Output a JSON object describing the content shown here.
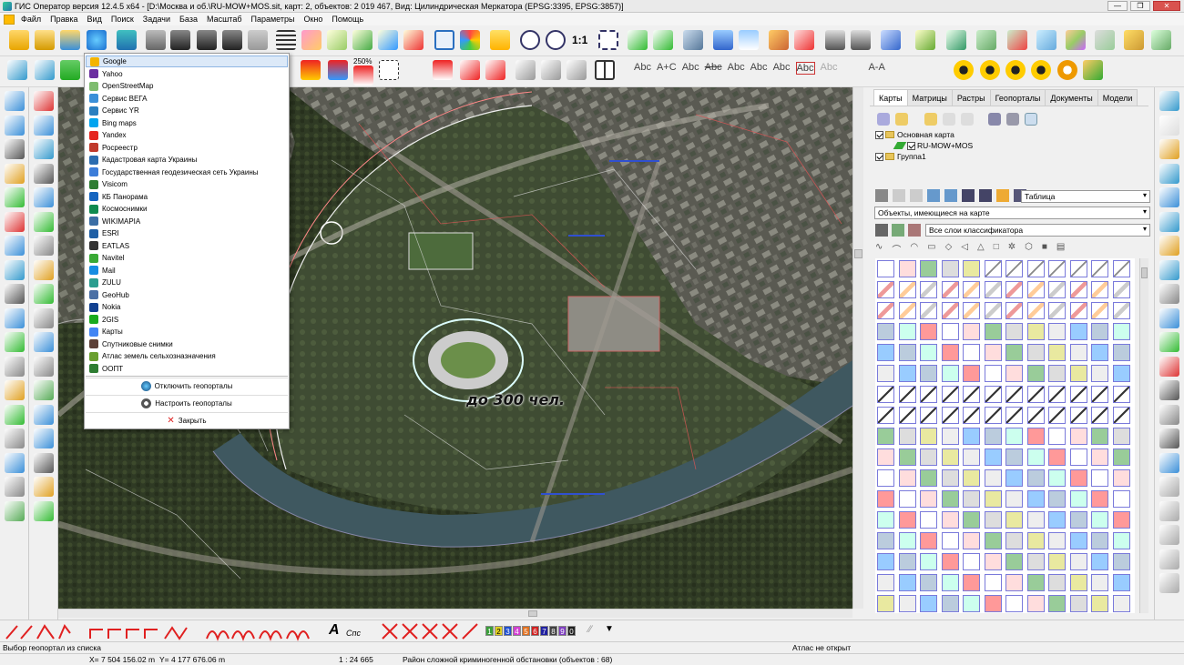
{
  "window": {
    "title": "ГИС Оператор версия 12.4.5 x64 - [D:\\Москва и об.\\RU-MOW+MOS.sit, карт: 2, объектов: 2 019 467, Вид: Цилиндрическая Меркатора (EPSG:3395, EPSG:3857)]",
    "minimize": "—",
    "maximize": "❐",
    "close": "✕"
  },
  "menu": [
    "Файл",
    "Правка",
    "Вид",
    "Поиск",
    "Задачи",
    "База",
    "Масштаб",
    "Параметры",
    "Окно",
    "Помощь"
  ],
  "toolbar": {
    "zoom_ratio": "1:1",
    "zoom_percent": "250%",
    "text_tools": [
      "Abc",
      "A+C",
      "Abc",
      "Abc",
      "Abc",
      "Abc",
      "Abc",
      "Abc",
      "Abc",
      "A-A"
    ]
  },
  "geoportal_menu": {
    "items": [
      {
        "label": "Google",
        "color": "#f4b400",
        "selected": true
      },
      {
        "label": "Yahoo",
        "color": "#6b2fa0"
      },
      {
        "label": "OpenStreetMap",
        "color": "#7ebc6f"
      },
      {
        "label": "Сервис ВЕГА",
        "color": "#3a8fd8"
      },
      {
        "label": "Сервис YR",
        "color": "#2a7fc0"
      },
      {
        "label": "Bing maps",
        "color": "#00a4ef"
      },
      {
        "label": "Yandex",
        "color": "#e52620"
      },
      {
        "label": "Росреестр",
        "color": "#c0392b"
      },
      {
        "label": "Кадастровая карта Украины",
        "color": "#2b6cb0"
      },
      {
        "label": "Государственная геодезическая сеть Украины",
        "color": "#3c7dd9"
      },
      {
        "label": "Visicom",
        "color": "#2e7d32"
      },
      {
        "label": "КБ Панорама",
        "color": "#1565c0"
      },
      {
        "label": "Космоснимки",
        "color": "#0f8a4f"
      },
      {
        "label": "WIKIMAPIA",
        "color": "#3b6ea5"
      },
      {
        "label": "ESRI",
        "color": "#1f5fa5"
      },
      {
        "label": "EATLAS",
        "color": "#333333"
      },
      {
        "label": "Navitel",
        "color": "#39a935"
      },
      {
        "label": "Mail",
        "color": "#168de2"
      },
      {
        "label": "ZULU",
        "color": "#2a9d8f"
      },
      {
        "label": "GeoHub",
        "color": "#4a6fa5"
      },
      {
        "label": "Nokia",
        "color": "#124191"
      },
      {
        "label": "2GIS",
        "color": "#19aa1e"
      },
      {
        "label": "Карты",
        "color": "#4285f4"
      },
      {
        "label": "Спутниковые снимки",
        "color": "#5d4037"
      },
      {
        "label": "Атлас земель сельхозназначения",
        "color": "#6a9f2f"
      },
      {
        "label": "ООПТ",
        "color": "#2e7d32"
      }
    ],
    "disable_label": "Отключить геопорталы",
    "configure_label": "Настроить геопорталы",
    "close_label": "Закрыть"
  },
  "map": {
    "labels": [
      "до 300 чел."
    ]
  },
  "right_panel": {
    "tabs": [
      "Карты",
      "Матрицы",
      "Растры",
      "Геопорталы",
      "Документы",
      "Модели"
    ],
    "active_tab": "Карты",
    "tree": {
      "root": "Основная карта",
      "child": "RU-MOW+MOS",
      "group": "Группа1"
    },
    "view_select": "Таблица",
    "objects_select": "Объекты, имеющиеся на карте",
    "layers_select": "Все слои классификатора"
  },
  "bottombar": {
    "digits": [
      "1",
      "2",
      "3",
      "4",
      "5",
      "6",
      "7",
      "8",
      "9",
      "0"
    ],
    "text_tool": "A",
    "spec_label": "Спс"
  },
  "status": {
    "hint": "Выбор геопортал из списка",
    "atlas": "Атлас не открыт",
    "x": "X= 7 504 156.02 m",
    "y": "Y= 4 177 676.06 m",
    "scale": "1 : 24 665",
    "area": "Район сложной криминогенной обстановки   (объектов : 68)"
  },
  "colors": {
    "accent": "#7a7adb",
    "selection": "#dce9f8",
    "digits": [
      "#3a9f3a",
      "#e0d020",
      "#2050d0",
      "#d040d0",
      "#e07020",
      "#d02020",
      "#2020a0",
      "#404040",
      "#8040c0",
      "#202020"
    ]
  }
}
